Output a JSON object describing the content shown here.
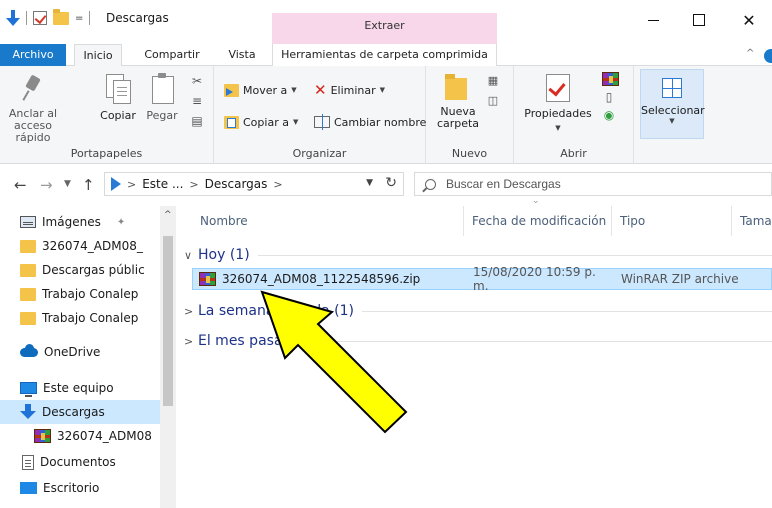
{
  "window": {
    "title": "Descargas",
    "context_tab_header": "Extraer",
    "close_glyph": "✕"
  },
  "quick_access": {
    "menu_glyph": "="
  },
  "ribbon_tabs": {
    "archivo": "Archivo",
    "inicio": "Inicio",
    "compartir": "Compartir",
    "vista": "Vista",
    "herramientas": "Herramientas de carpeta comprimida",
    "collapse_glyph": "^"
  },
  "ribbon": {
    "portapapeles": {
      "anclar": "Anclar al acceso rápido",
      "copiar": "Copiar",
      "pegar": "Pegar",
      "label": "Portapapeles"
    },
    "organizar": {
      "mover": "Mover a",
      "copiar": "Copiar a",
      "eliminar": "Eliminar",
      "cambiar_nombre": "Cambiar nombre",
      "label": "Organizar"
    },
    "nuevo": {
      "nueva_carpeta": "Nueva carpeta",
      "label": "Nuevo"
    },
    "abrir": {
      "propiedades": "Propiedades",
      "label": "Abrir"
    },
    "seleccionar": {
      "label_btn": "Seleccionar"
    }
  },
  "address": {
    "crumbs": [
      "Este ...",
      "Descargas"
    ],
    "separator": ">",
    "search_placeholder": "Buscar en Descargas"
  },
  "nav": {
    "items": [
      {
        "label": "Imágenes"
      },
      {
        "label": "326074_ADM08_"
      },
      {
        "label": "Descargas públic"
      },
      {
        "label": "Trabajo Conalep"
      },
      {
        "label": "Trabajo Conalep"
      },
      {
        "label": "OneDrive"
      },
      {
        "label": "Este equipo"
      },
      {
        "label": "Descargas"
      },
      {
        "label": "326074_ADM08"
      },
      {
        "label": "Documentos"
      },
      {
        "label": "Escritorio"
      }
    ]
  },
  "columns": {
    "name": "Nombre",
    "date": "Fecha de modificación",
    "type": "Tipo",
    "size": "Tama"
  },
  "groups": {
    "hoy": "Hoy (1)",
    "semana": "La semana pasada (1)",
    "mes": "El mes pasado"
  },
  "file": {
    "name": "326074_ADM08_1122548596.zip",
    "date": "15/08/2020 10:59 p. m.",
    "type": "WinRAR ZIP archive"
  },
  "colors": {
    "accent": "#1979ca",
    "selection": "#cce8ff",
    "context_tab": "#f9d7ea",
    "arrow_fill": "#ffff00"
  }
}
